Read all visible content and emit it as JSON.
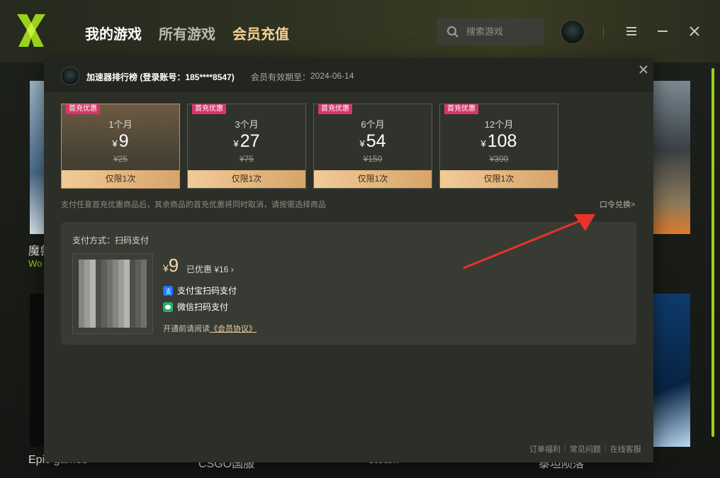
{
  "app": {
    "nav": [
      "我的游戏",
      "所有游戏",
      "会员充值"
    ],
    "search_placeholder": "搜索游戏",
    "games": [
      {
        "title": "魔兽",
        "subtitle": "Wo"
      },
      {
        "title": "Epic games"
      },
      {
        "title": "CSGO国服"
      },
      {
        "title": "steam"
      },
      {
        "title": "泰坦陨落"
      }
    ]
  },
  "modal": {
    "account_line": "加速器排行榜 (登录账号：185****8547)",
    "expire_label": "会员有效期至：",
    "expire_date": "2024-06-14",
    "plans": [
      {
        "tag": "首充优惠",
        "duration": "1个月",
        "currency": "¥",
        "price": "9",
        "original": "¥25",
        "limit": "仅限1次",
        "selected": true
      },
      {
        "tag": "首充优惠",
        "duration": "3个月",
        "currency": "¥",
        "price": "27",
        "original": "¥75",
        "limit": "仅限1次",
        "selected": false
      },
      {
        "tag": "首充优惠",
        "duration": "6个月",
        "currency": "¥",
        "price": "54",
        "original": "¥150",
        "limit": "仅限1次",
        "selected": false
      },
      {
        "tag": "首充优惠",
        "duration": "12个月",
        "currency": "¥",
        "price": "108",
        "original": "¥300",
        "limit": "仅限1次",
        "selected": false
      }
    ],
    "note": "支付任意首充优惠商品后，其余商品的首充优惠将同时取消，请按需选择商品",
    "redeem": "口令兑换>",
    "payment": {
      "method_label": "支付方式：扫码支付",
      "currency": "¥",
      "price": "9",
      "saved": "已优惠 ¥16 ›",
      "alipay": "支付宝扫码支付",
      "wechat": "微信扫码支付",
      "agree_prefix": "开通前请阅读",
      "agree_link": "《会员协议》"
    },
    "footer": [
      "订单福利",
      "常见问题",
      "在线客服"
    ]
  },
  "colors": {
    "accent_green": "#9ad21a",
    "vip_gold": "#f4cf95",
    "tag_pink": "#d8356c",
    "annotation_arrow": "#e8322c"
  }
}
